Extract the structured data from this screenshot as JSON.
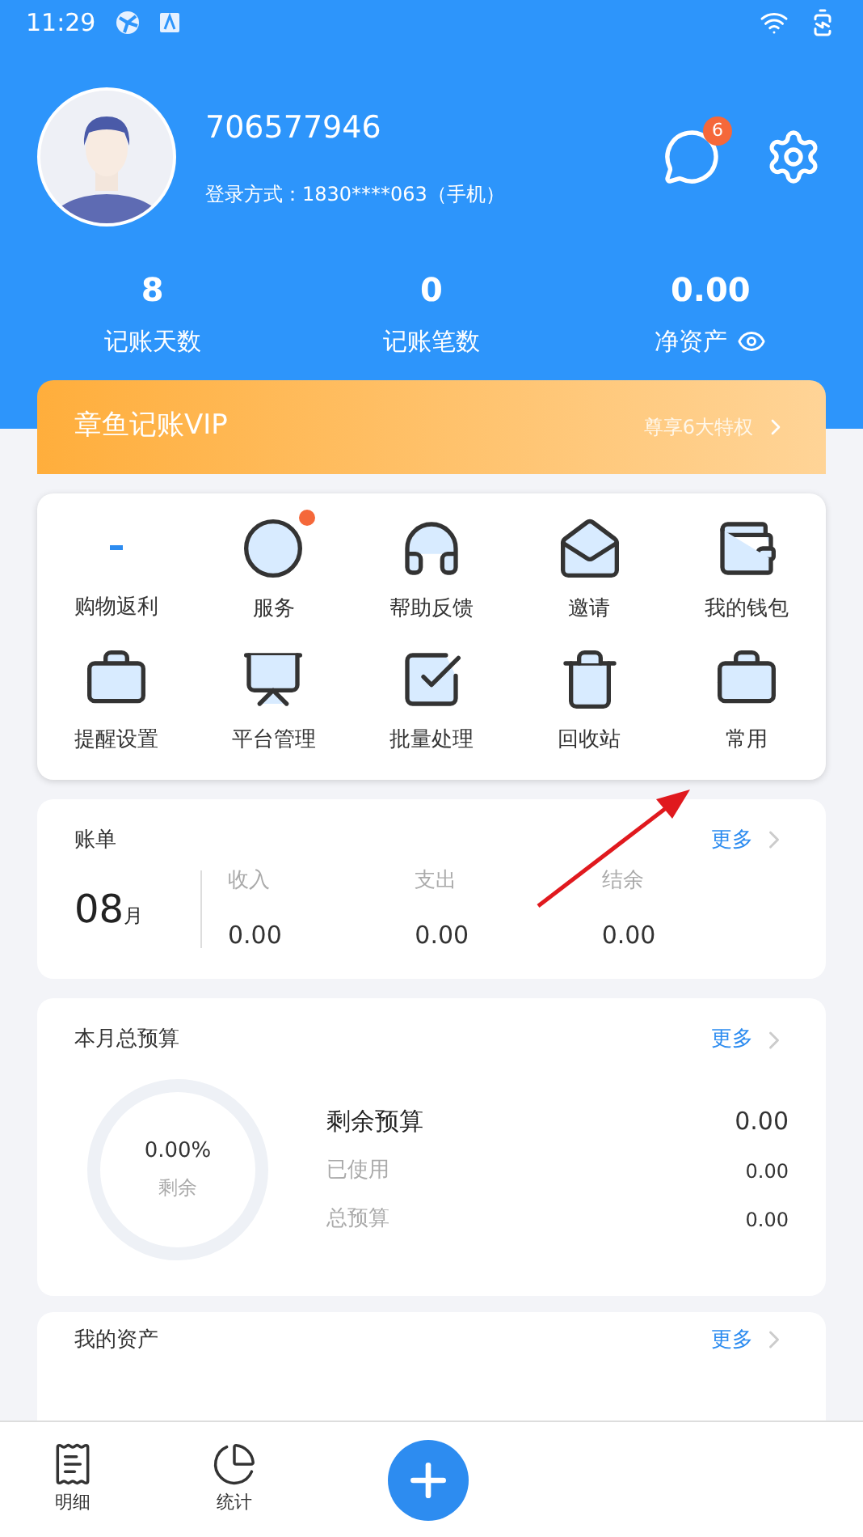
{
  "status_bar": {
    "time": "11:29"
  },
  "profile": {
    "user_id": "706577946",
    "login": "登录方式：1830****063（手机）",
    "message_badge": "6"
  },
  "stats": [
    {
      "value": "8",
      "label": "记账天数",
      "kind": "plain"
    },
    {
      "value": "0",
      "label": "记账笔数",
      "kind": "plain"
    },
    {
      "value": "0.00",
      "label": "净资产",
      "kind": "eye"
    }
  ],
  "vip_banner": {
    "title": "章鱼记账VIP",
    "link": "尊享6大特权"
  },
  "shortcuts": [
    {
      "label": "购物返利",
      "dot": false
    },
    {
      "label": "服务",
      "dot": true
    },
    {
      "label": "帮助反馈",
      "dot": false
    },
    {
      "label": "邀请",
      "dot": false
    },
    {
      "label": "我的钱包",
      "dot": false
    },
    {
      "label": "提醒设置",
      "dot": false
    },
    {
      "label": "平台管理",
      "dot": false
    },
    {
      "label": "批量处理",
      "dot": false
    },
    {
      "label": "回收站",
      "dot": false
    },
    {
      "label": "常用",
      "dot": false
    }
  ],
  "bill": {
    "title": "账单",
    "more": "更多",
    "month": "08",
    "month_unit": "月",
    "columns": [
      {
        "label": "收入",
        "value": "0.00"
      },
      {
        "label": "支出",
        "value": "0.00"
      },
      {
        "label": "结余",
        "value": "0.00"
      }
    ]
  },
  "budget": {
    "title": "本月总预算",
    "more": "更多",
    "percent": "0.00%",
    "ring_label": "剩余",
    "rows": [
      {
        "label": "剩余预算",
        "value": "0.00",
        "kind": "primary"
      },
      {
        "label": "已使用",
        "value": "0.00",
        "kind": "secondary"
      },
      {
        "label": "总预算",
        "value": "0.00",
        "kind": "secondary"
      }
    ]
  },
  "assets": {
    "title": "我的资产",
    "more": "更多"
  },
  "bottom_nav": [
    {
      "label": "明细"
    },
    {
      "label": "统计"
    }
  ]
}
